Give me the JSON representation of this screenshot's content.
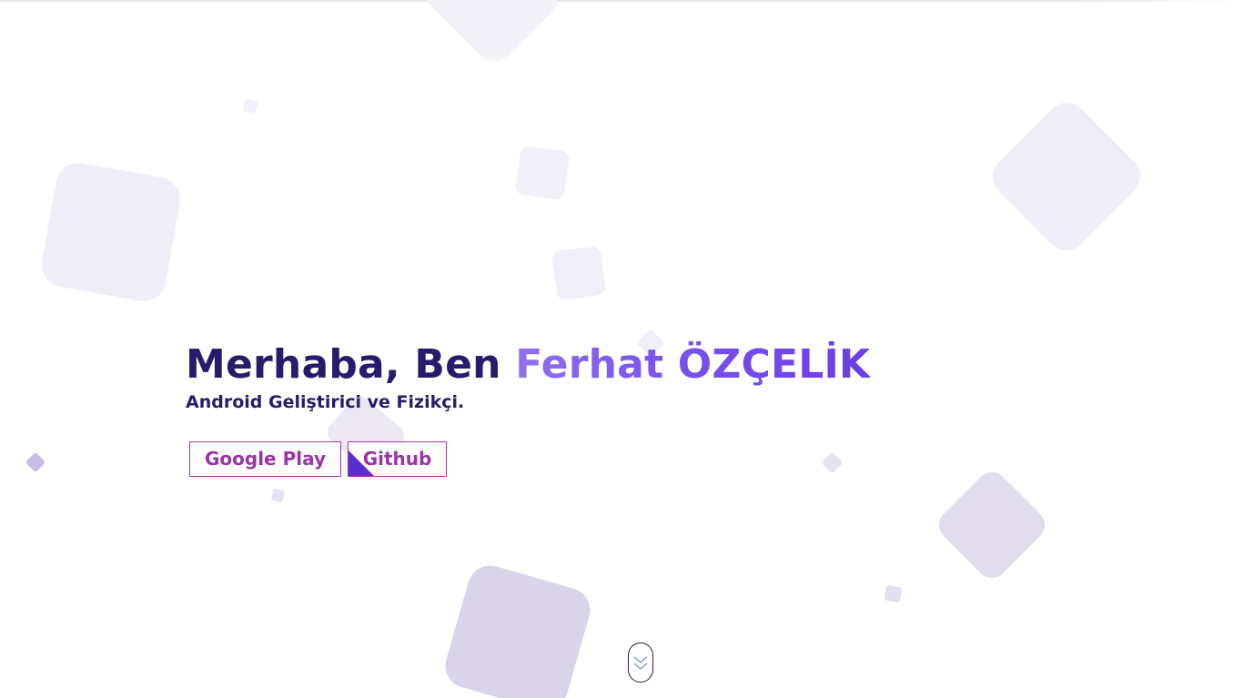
{
  "hero": {
    "greeting": "Merhaba, Ben ",
    "name": "Ferhat ÖZÇELİK",
    "subtitle": "Android Geliştirici ve Fizikçi."
  },
  "buttons": {
    "google_play_label": "Google Play",
    "github_label": "Github"
  },
  "scroll_indicator": {
    "icon": "double-chevron-down-icon"
  },
  "colors": {
    "heading": "#2a1a6b",
    "name_gradient_start": "#9170f0",
    "name_gradient_end": "#6a3ee8",
    "button_border": "#a23aa6",
    "button_text": "#9a35a6",
    "button_corner": "#5a2fd0",
    "shape_light": "#f0eef7",
    "shape_mid": "#e2def0",
    "shape_dark": "#d8d2ea"
  }
}
